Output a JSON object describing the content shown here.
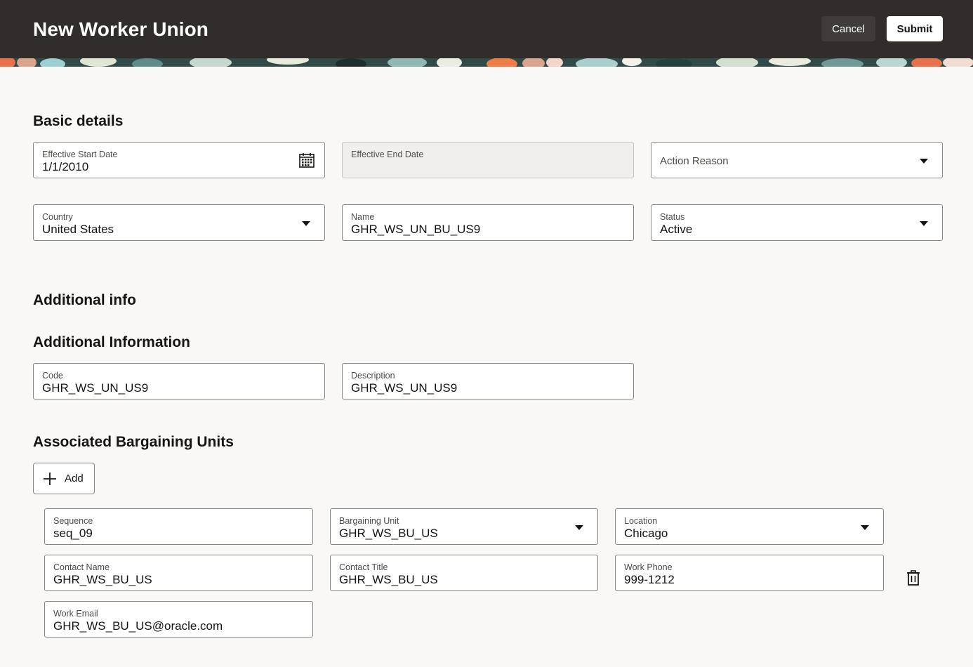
{
  "header": {
    "title": "New Worker Union",
    "cancel_label": "Cancel",
    "submit_label": "Submit"
  },
  "basic_details": {
    "title": "Basic details",
    "effective_start_date": {
      "label": "Effective Start Date",
      "value": "1/1/2010"
    },
    "effective_end_date": {
      "label": "Effective End Date",
      "value": ""
    },
    "action_reason": {
      "placeholder": "Action Reason"
    },
    "country": {
      "label": "Country",
      "value": "United States"
    },
    "name": {
      "label": "Name",
      "value": "GHR_WS_UN_BU_US9"
    },
    "status": {
      "label": "Status",
      "value": "Active"
    }
  },
  "additional_info": {
    "title": "Additional info",
    "subtitle": "Additional Information",
    "code": {
      "label": "Code",
      "value": "GHR_WS_UN_US9"
    },
    "description": {
      "label": "Description",
      "value": "GHR_WS_UN_US9"
    }
  },
  "bargaining_units": {
    "title": "Associated Bargaining Units",
    "add_label": "Add",
    "row": {
      "sequence": {
        "label": "Sequence",
        "value": "seq_09"
      },
      "bargaining_unit": {
        "label": "Bargaining Unit",
        "value": "GHR_WS_BU_US"
      },
      "location": {
        "label": "Location",
        "value": "Chicago"
      },
      "contact_name": {
        "label": "Contact Name",
        "value": "GHR_WS_BU_US"
      },
      "contact_title": {
        "label": "Contact Title",
        "value": "GHR_WS_BU_US"
      },
      "work_phone": {
        "label": "Work Phone",
        "value": "999-1212"
      },
      "work_email": {
        "label": "Work Email",
        "value": "GHR_WS_BU_US@oracle.com"
      }
    }
  },
  "icons": {
    "calendar": "calendar-icon",
    "dropdown": "chevron-down-icon",
    "add": "plus-icon",
    "delete": "trash-icon"
  },
  "colors": {
    "header_bg": "#312d2a",
    "page_bg": "#f9f8f6",
    "cancel_bg": "#3f3b38"
  }
}
